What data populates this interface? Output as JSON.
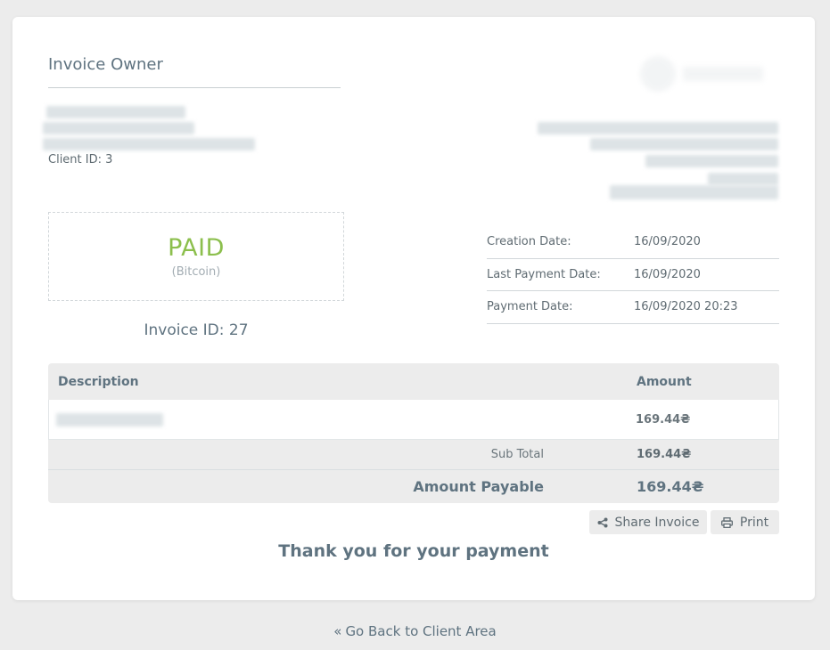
{
  "owner": {
    "title": "Invoice Owner",
    "client_id": "Client ID: 3"
  },
  "status": {
    "label": "PAID",
    "method": "(Bitcoin)"
  },
  "invoice_id": "Invoice ID: 27",
  "dates": [
    {
      "label": "Creation Date:",
      "value": "16/09/2020"
    },
    {
      "label": "Last Payment Date:",
      "value": "16/09/2020"
    },
    {
      "label": "Payment Date:",
      "value": "16/09/2020 20:23"
    }
  ],
  "table": {
    "headers": {
      "description": "Description",
      "amount": "Amount"
    },
    "rows": [
      {
        "amount": "169.44₴"
      }
    ],
    "subtotal_label": "Sub Total",
    "subtotal_value": "169.44₴",
    "total_label": "Amount Payable",
    "total_value": "169.44₴"
  },
  "buttons": {
    "share": "Share Invoice",
    "print": "Print"
  },
  "thanks": "Thank you for your payment",
  "back_link": "Go Back to Client Area",
  "colors": {
    "paid": "#8cbf4d",
    "background": "#ececec",
    "text": "#5f7380"
  },
  "icons": {
    "share": "share-icon",
    "print": "printer-icon",
    "back": "double-chevron-left-icon"
  }
}
